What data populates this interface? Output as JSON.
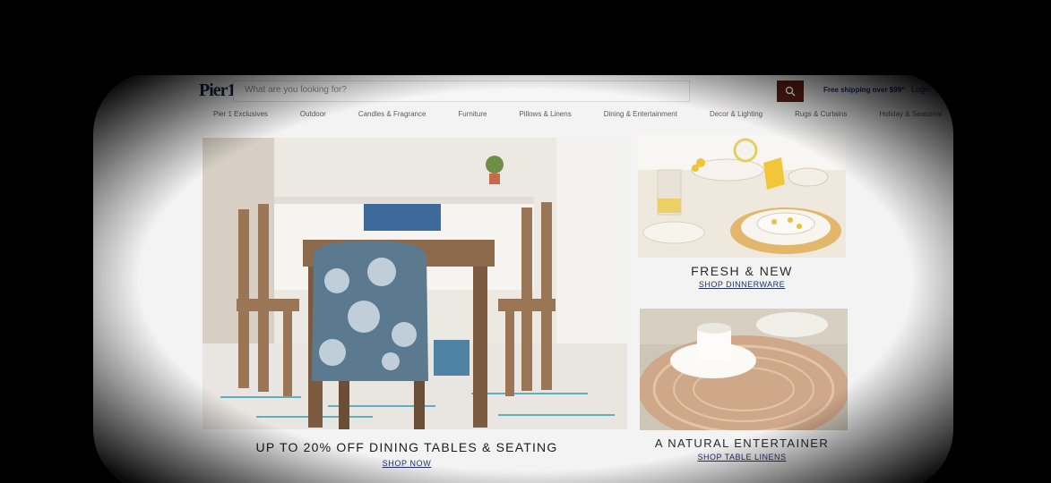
{
  "brand": {
    "logo": "Pier1",
    "accent": "#5a1e14",
    "navy": "#1e2f6b"
  },
  "search": {
    "placeholder": "What are you looking for?",
    "icon": "search-icon"
  },
  "header": {
    "shipping_text": "Free shipping over $99*",
    "login_label": "Login",
    "cart_icon": "cart-icon"
  },
  "nav": {
    "items": [
      "Pier 1 Exclusives",
      "Outdoor",
      "Candles & Fragrance",
      "Furniture",
      "Pillows & Linens",
      "Dining & Entertainment",
      "Decor & Lighting",
      "Rugs & Curtains",
      "Holiday & Seasonal"
    ]
  },
  "hero": {
    "title": "UP TO 20% OFF DINING TABLES & SEATING",
    "link": "SHOP NOW"
  },
  "promo1": {
    "title": "FRESH & NEW",
    "link": "SHOP DINNERWARE"
  },
  "promo2": {
    "title": "A NATURAL ENTERTAINER",
    "link": "SHOP TABLE LINENS"
  }
}
